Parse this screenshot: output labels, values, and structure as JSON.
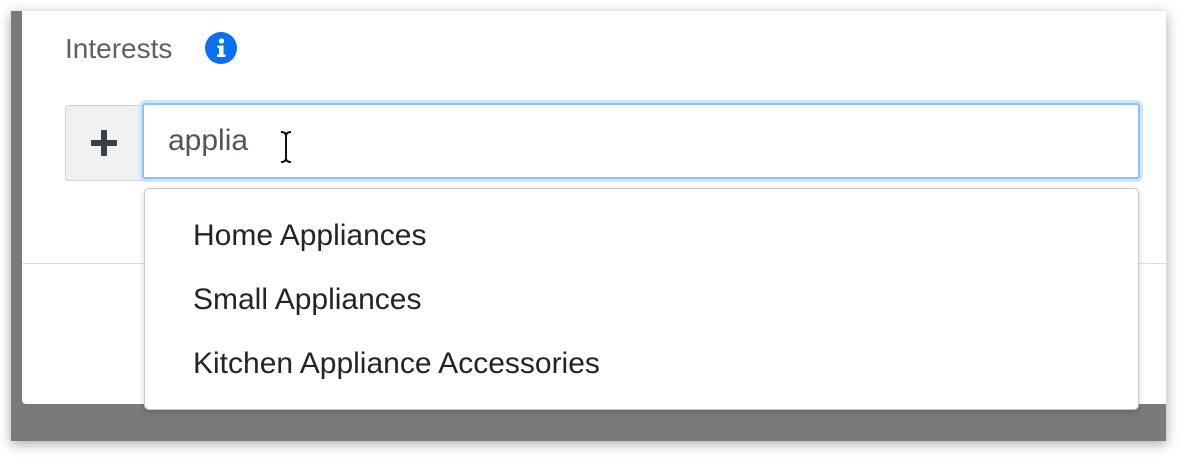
{
  "form": {
    "interests_label": "Interests",
    "info_icon": "info-circle-icon",
    "add_icon": "plus-icon",
    "search_value": "applia",
    "accent_color": "#0b6ff0"
  },
  "dropdown": {
    "options": [
      "Home Appliances",
      "Small Appliances",
      "Kitchen Appliance Accessories"
    ]
  }
}
